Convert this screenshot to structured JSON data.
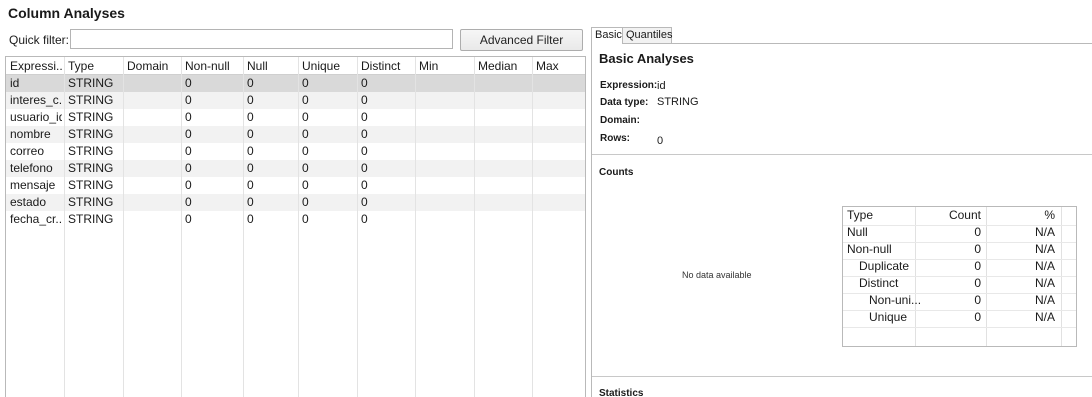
{
  "title": "Column Analyses",
  "quick_filter": {
    "label": "Quick filter:",
    "value": "",
    "placeholder": ""
  },
  "advanced_filter_label": "Advanced Filter",
  "grid": {
    "columns": [
      "Expressi...",
      "Type",
      "Domain",
      "Non-null",
      "Null",
      "Unique",
      "Distinct",
      "Min",
      "Median",
      "Max"
    ],
    "rows": [
      [
        "id",
        "STRING",
        "",
        "0",
        "0",
        "0",
        "0",
        "",
        "",
        ""
      ],
      [
        "interes_c...",
        "STRING",
        "",
        "0",
        "0",
        "0",
        "0",
        "",
        "",
        ""
      ],
      [
        "usuario_id",
        "STRING",
        "",
        "0",
        "0",
        "0",
        "0",
        "",
        "",
        ""
      ],
      [
        "nombre",
        "STRING",
        "",
        "0",
        "0",
        "0",
        "0",
        "",
        "",
        ""
      ],
      [
        "correo",
        "STRING",
        "",
        "0",
        "0",
        "0",
        "0",
        "",
        "",
        ""
      ],
      [
        "telefono",
        "STRING",
        "",
        "0",
        "0",
        "0",
        "0",
        "",
        "",
        ""
      ],
      [
        "mensaje",
        "STRING",
        "",
        "0",
        "0",
        "0",
        "0",
        "",
        "",
        ""
      ],
      [
        "estado",
        "STRING",
        "",
        "0",
        "0",
        "0",
        "0",
        "",
        "",
        ""
      ],
      [
        "fecha_cr...",
        "STRING",
        "",
        "0",
        "0",
        "0",
        "0",
        "",
        "",
        ""
      ]
    ],
    "selected_row": 0
  },
  "tabs": [
    "Basic",
    "Quantiles"
  ],
  "active_tab": "Basic",
  "basic": {
    "title": "Basic Analyses",
    "expression_label": "Expression:",
    "expression_value": "id",
    "data_type_label": "Data type:",
    "data_type_value": "STRING",
    "domain_label": "Domain:",
    "domain_value": "",
    "rows_label": "Rows:",
    "rows_value": "0"
  },
  "counts": {
    "title": "Counts",
    "no_data": "No data available",
    "headers": [
      "Type",
      "Count",
      "%"
    ],
    "rows": [
      [
        "Null",
        "0",
        "N/A"
      ],
      [
        "Non-null",
        "0",
        "N/A"
      ],
      [
        "Duplicate",
        "0",
        "N/A"
      ],
      [
        "Distinct",
        "0",
        "N/A"
      ],
      [
        "Non-uni...",
        "0",
        "N/A"
      ],
      [
        "Unique",
        "0",
        "N/A"
      ]
    ]
  },
  "statistics_title": "Statistics",
  "colors": {
    "selected_row": "#d9d9d9",
    "alt_row": "#f2f2f2",
    "border": "#b9b9b9"
  }
}
